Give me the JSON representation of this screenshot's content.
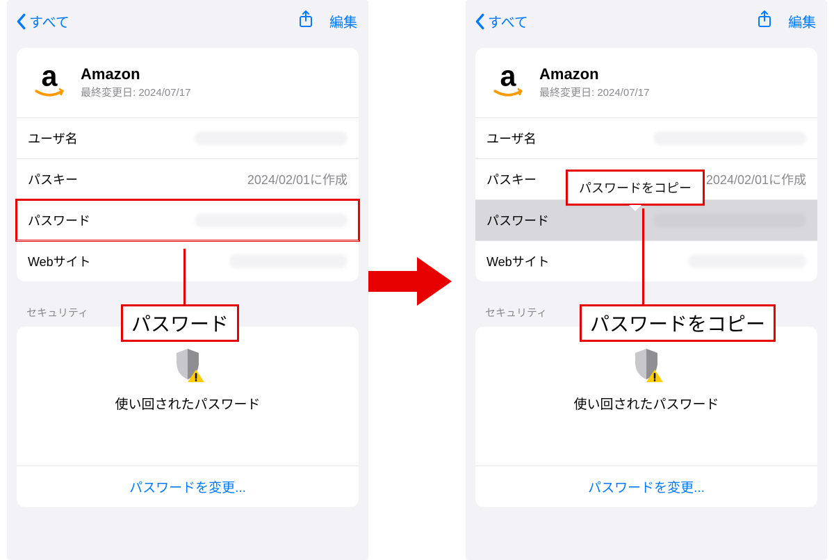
{
  "nav": {
    "back": "すべて",
    "edit": "編集"
  },
  "account": {
    "name": "Amazon",
    "lastModified": "最終変更日: 2024/07/17"
  },
  "rows": {
    "username": "ユーザ名",
    "passkey_label": "パスキー",
    "passkey_value": "2024/02/01に作成",
    "password": "パスワード",
    "website": "Webサイト"
  },
  "security": {
    "section": "セキュリティ",
    "reused": "使い回されたパスワード",
    "change": "パスワードを変更..."
  },
  "annotations": {
    "callout_left": "パスワード",
    "callout_right": "パスワードをコピー",
    "popover": "パスワードをコピー"
  }
}
